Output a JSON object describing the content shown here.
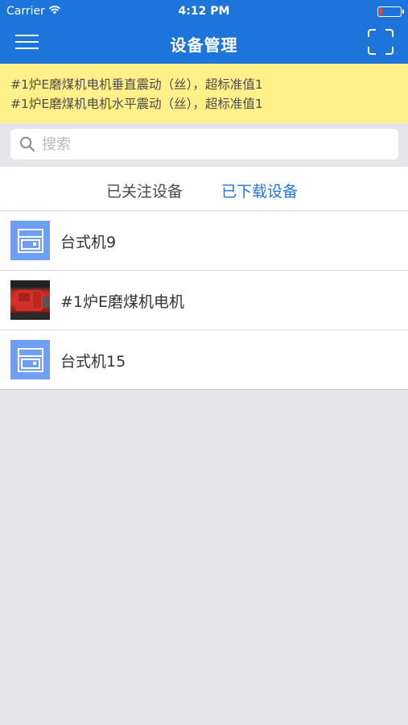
{
  "status_bar": {
    "carrier": "Carrier",
    "time": "4:12 PM",
    "battery_level": 0.15,
    "battery_color": "#ff3b30"
  },
  "nav": {
    "title": "设备管理",
    "menu_icon": "hamburger-menu-icon",
    "scan_icon": "scan-frame-icon"
  },
  "alert": {
    "lines": [
      "#1炉E磨煤机电机垂直震动（丝），超标准值1",
      "#1炉E磨煤机电机水平震动（丝），超标准值1"
    ],
    "background": "#fff08a"
  },
  "search": {
    "placeholder": "搜索",
    "value": ""
  },
  "tabs": {
    "followed": "已关注设备",
    "downloaded": "已下载设备",
    "active": "downloaded"
  },
  "devices": [
    {
      "name": "台式机9",
      "thumb": "device-cabinet-icon"
    },
    {
      "name": "#1炉E磨煤机电机",
      "thumb": "motor-photo"
    },
    {
      "name": "台式机15",
      "thumb": "device-cabinet-icon"
    }
  ],
  "colors": {
    "primary": "#1d74db",
    "icon_bg": "#6e9ef5",
    "page_bg": "#e6e6ea"
  }
}
